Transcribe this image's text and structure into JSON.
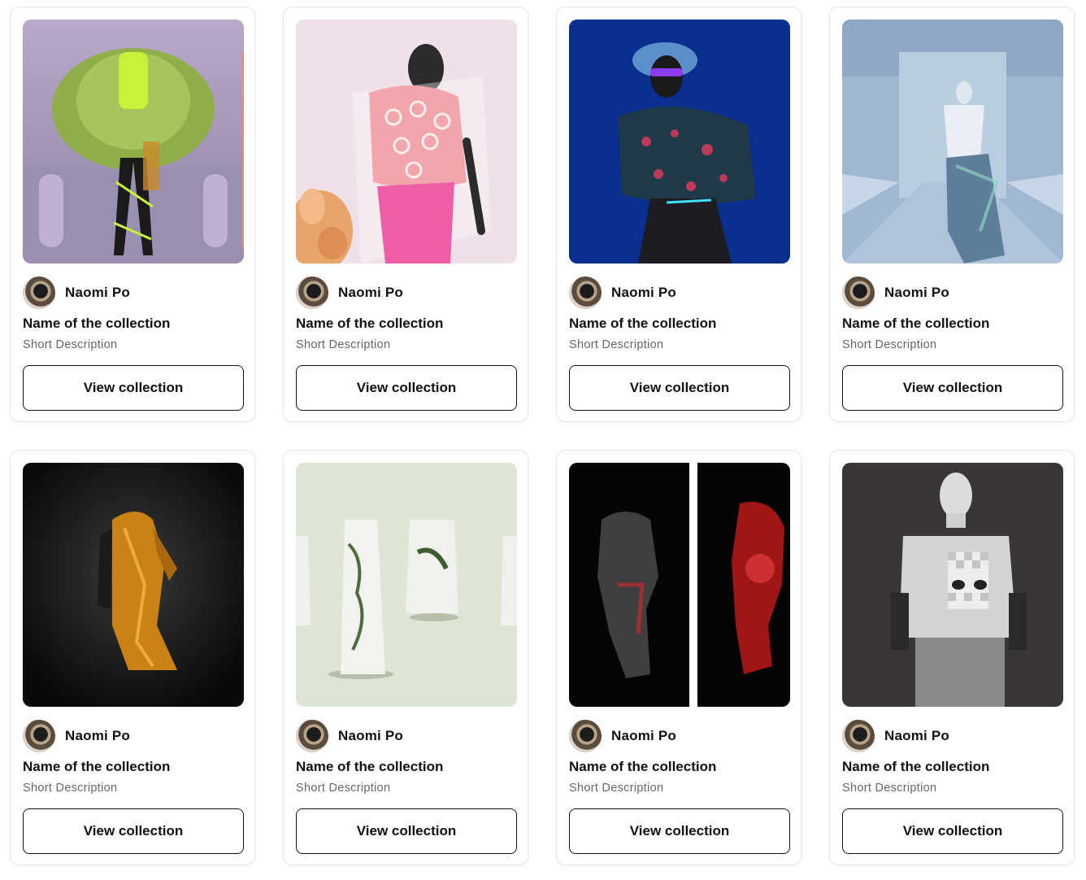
{
  "cards": [
    {
      "author": "Naomi Po",
      "title": "Name of the collection",
      "description": "Short Description",
      "button": "View collection",
      "image": "green-puffer-jacket-look"
    },
    {
      "author": "Naomi Po",
      "title": "Name of the collection",
      "description": "Short Description",
      "button": "View collection",
      "image": "pink-patterned-outfit-look"
    },
    {
      "author": "Naomi Po",
      "title": "Name of the collection",
      "description": "Short Description",
      "button": "View collection",
      "image": "blue-background-sunglasses-look"
    },
    {
      "author": "Naomi Po",
      "title": "Name of the collection",
      "description": "Short Description",
      "button": "View collection",
      "image": "runway-iridescent-dress-look"
    },
    {
      "author": "Naomi Po",
      "title": "Name of the collection",
      "description": "Short Description",
      "button": "View collection",
      "image": "gold-draped-gown"
    },
    {
      "author": "Naomi Po",
      "title": "Name of the collection",
      "description": "Short Description",
      "button": "View collection",
      "image": "white-printed-dresses"
    },
    {
      "author": "Naomi Po",
      "title": "Name of the collection",
      "description": "Short Description",
      "button": "View collection",
      "image": "wireframe-red-garments"
    },
    {
      "author": "Naomi Po",
      "title": "Name of the collection",
      "description": "Short Description",
      "button": "View collection",
      "image": "checkered-sweater-mannequin"
    }
  ]
}
